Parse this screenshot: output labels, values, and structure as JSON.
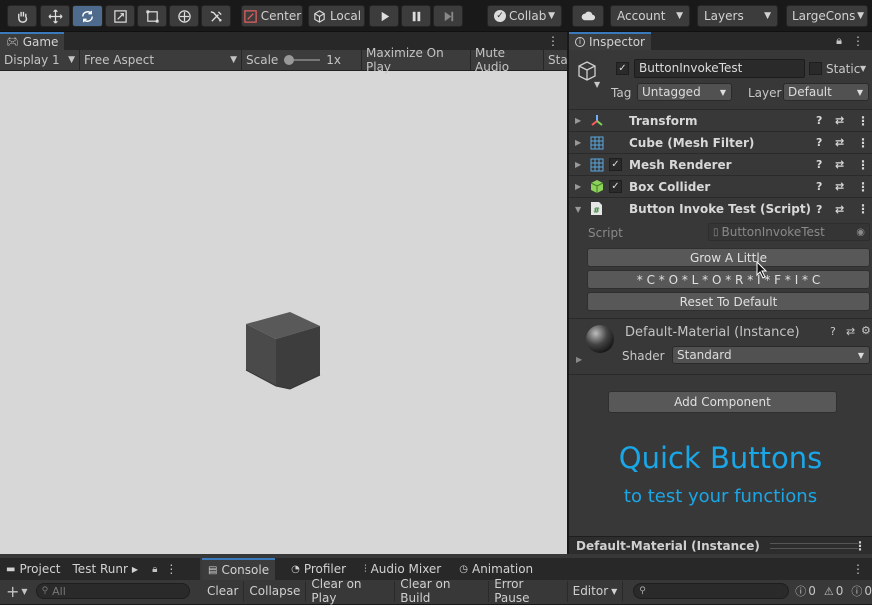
{
  "toolbar": {
    "center_label": "Center",
    "local_label": "Local",
    "collab_label": "Collab",
    "account_label": "Account",
    "layers_label": "Layers",
    "layout_label": "LargeCons"
  },
  "game": {
    "tab_label": "Game",
    "display": "Display 1",
    "aspect": "Free Aspect",
    "scale_label": "Scale",
    "scale_value": "1x",
    "maximize": "Maximize On Play",
    "mute": "Mute Audio",
    "stats": "Sta"
  },
  "inspector": {
    "tab_label": "Inspector",
    "object_name": "ButtonInvokeTest",
    "static_label": "Static",
    "tag_label": "Tag",
    "tag_value": "Untagged",
    "layer_label": "Layer",
    "layer_value": "Default",
    "components": [
      "Transform",
      "Cube (Mesh Filter)",
      "Mesh Renderer",
      "Box Collider",
      "Button Invoke Test (Script)"
    ],
    "script_label": "Script",
    "script_value": "ButtonInvokeTest",
    "buttons": [
      "Grow A Little",
      "* C * O * L * O * R * I * F * I * C",
      "Reset To Default"
    ],
    "material_name": "Default-Material (Instance)",
    "shader_label": "Shader",
    "shader_value": "Standard",
    "add_component": "Add Component",
    "promo_title": "Quick Buttons",
    "promo_sub": "to test your functions",
    "footer_label": "Default-Material (Instance)"
  },
  "bottom": {
    "project_tab": "Project",
    "testrunner_tab": "Test Runr",
    "console_tab": "Console",
    "profiler_tab": "Profiler",
    "audiomixer_tab": "Audio Mixer",
    "animation_tab": "Animation",
    "search_placeholder": "All",
    "clear": "Clear",
    "collapse": "Collapse",
    "clear_on_play": "Clear on Play",
    "clear_on_build": "Clear on Build",
    "error_pause": "Error Pause",
    "editor": "Editor",
    "count_log": "0",
    "count_warn": "0",
    "count_err": "0"
  },
  "colors": {
    "accent": "#3a79bb",
    "promo": "#1aa7e8"
  }
}
